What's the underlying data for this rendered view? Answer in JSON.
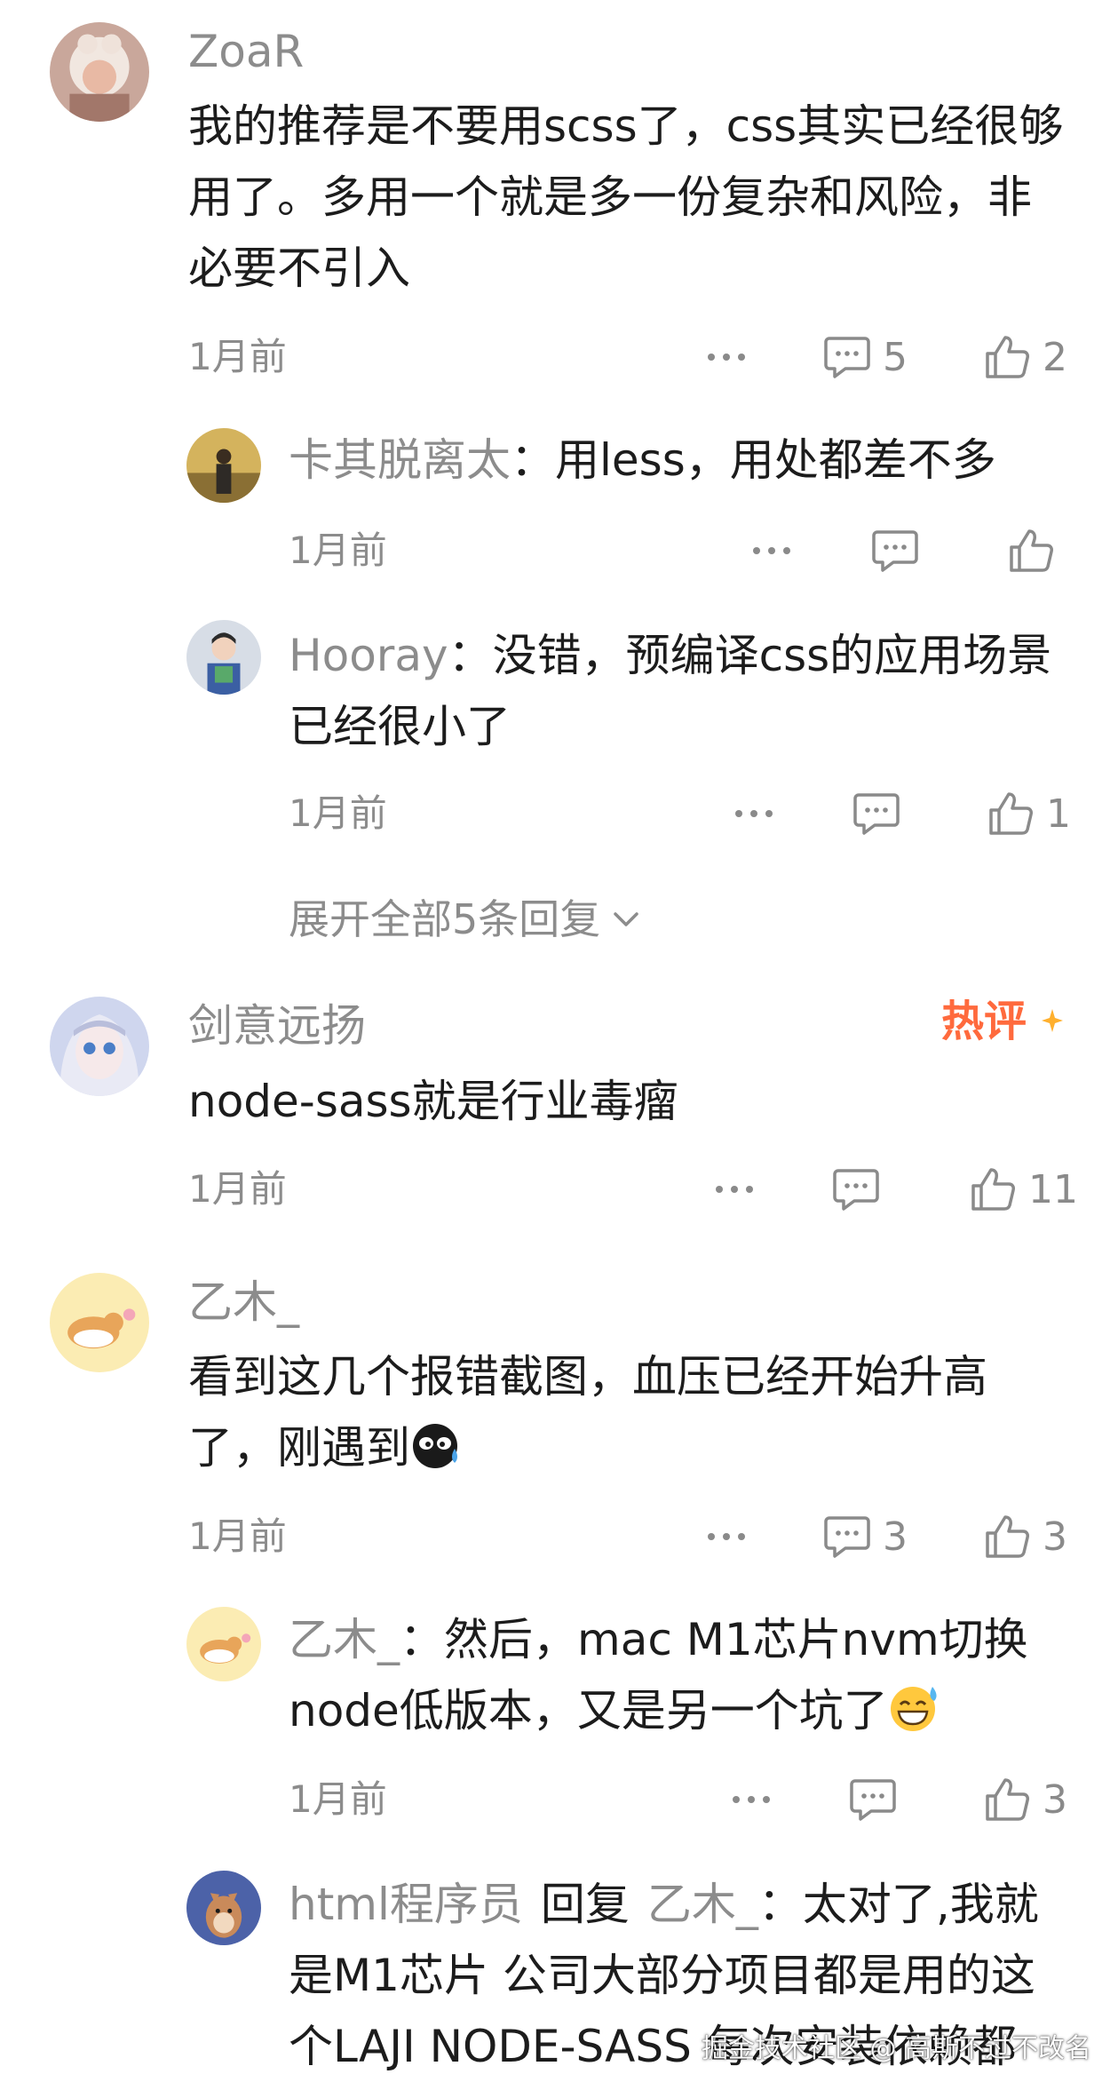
{
  "comments": [
    {
      "name": "ZoaR",
      "text": "我的推荐是不要用scss了，css其实已经很够用了。多用一个就是多一份复杂和风险，非必要不引入",
      "time": "1月前",
      "reply_count": "5",
      "like_count": "2"
    },
    {
      "name": "剑意远扬",
      "badge": "热评",
      "text": "node-sass就是行业毒瘤",
      "time": "1月前",
      "like_count": "11"
    },
    {
      "name": "乙木_",
      "text": "看到这几个报错截图，血压已经开始升高了，刚遇到",
      "time": "1月前",
      "reply_count": "3",
      "like_count": "3"
    }
  ],
  "replies": [
    {
      "name": "卡其脱离太",
      "sep": "：",
      "text": "用less，用处都差不多",
      "time": "1月前"
    },
    {
      "name": "Hooray",
      "sep": "：",
      "text": "没错，预编译css的应用场景已经很小了",
      "time": "1月前",
      "like_count": "1"
    },
    {
      "name": "乙木_",
      "sep": "：",
      "text": "然后，mac M1芯片nvm切换node低版本，又是另一个坑了",
      "time": "1月前",
      "like_count": "3"
    },
    {
      "name": "html程序员",
      "reply_word": "回复",
      "target": "乙木_",
      "sep": "：",
      "text": "太对了,我就是M1芯片 公司大部分项目都是用的这个LAJI NODE-SASS 每次安装依赖都"
    }
  ],
  "expand_label": "展开全部5条回复",
  "watermark": "掘金技术社区 @ 高斯不过不改名",
  "icons": {
    "more": "more-dots-icon",
    "comment": "comment-bubble-icon",
    "like": "thumbs-up-icon",
    "expand": "chevron-down-icon",
    "hot_spark": "sparkle-icon",
    "emoji_crying": "crying-face-emoji",
    "emoji_grin_sweat": "grinning-sweat-emoji"
  },
  "colors": {
    "text_primary": "#1c1c1c",
    "text_secondary": "#8c8c8c",
    "hot_badge": "#ff6a3d"
  }
}
